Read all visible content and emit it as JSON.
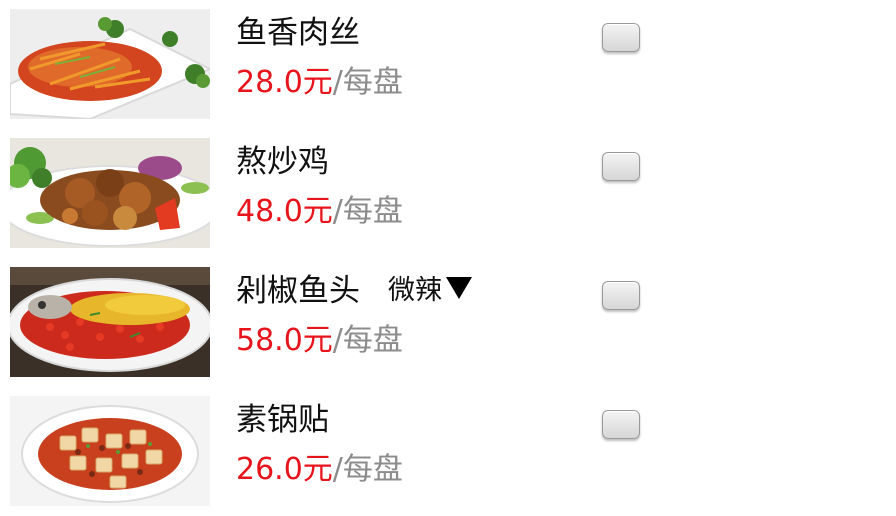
{
  "menu": {
    "items": [
      {
        "name": "鱼香肉丝",
        "price": "28.0元",
        "unit": "/每盘",
        "photo_icon": "yuxiang-rousi-photo",
        "selected": false
      },
      {
        "name": "熬炒鸡",
        "price": "48.0元",
        "unit": "/每盘",
        "photo_icon": "aochao-ji-photo",
        "selected": false
      },
      {
        "name": "剁椒鱼头",
        "price": "58.0元",
        "unit": "/每盘",
        "spice_level": "微辣",
        "photo_icon": "duojiao-yutou-photo",
        "selected": false
      },
      {
        "name": "素锅贴",
        "price": "26.0元",
        "unit": "/每盘",
        "photo_icon": "su-guotie-photo",
        "selected": false
      }
    ]
  },
  "colors": {
    "price": "#e8141b",
    "unit": "#8c8c8c",
    "name": "#111111"
  }
}
